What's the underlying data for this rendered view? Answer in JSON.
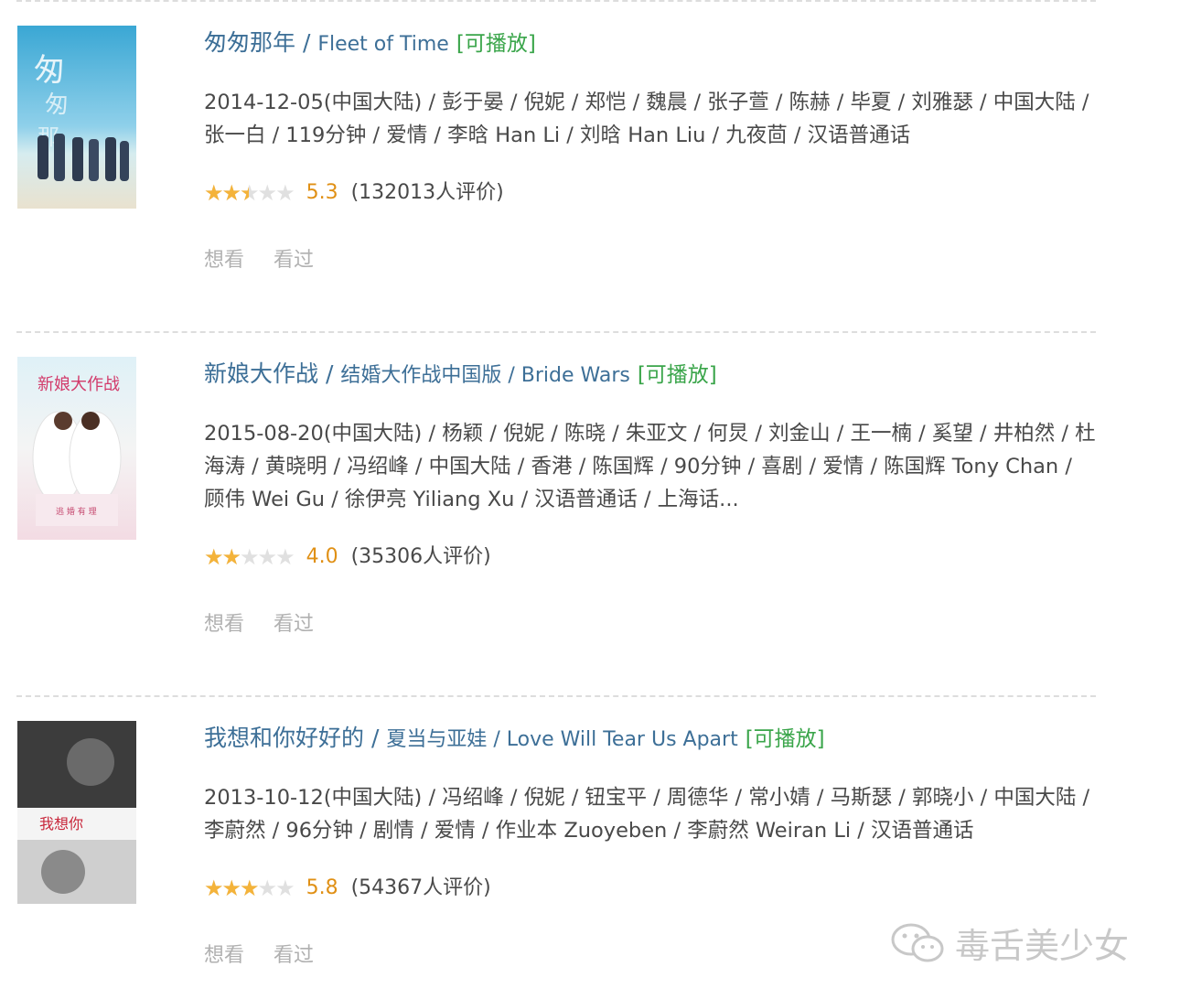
{
  "movies": [
    {
      "title": "匆匆那年",
      "alt_titles": "Fleet of Time",
      "playable": "[可播放]",
      "meta": "2014-12-05(中国大陆) / 彭于晏 / 倪妮 / 郑恺 / 魏晨 / 张子萱 / 陈赫 / 毕夏 / 刘雅瑟 / 中国大陆 / 张一白 / 119分钟 / 爱情 / 李晗 Han Li / 刘晗 Han Liu / 九夜茴 / 汉语普通话",
      "rating": 5.3,
      "score_text": "5.3",
      "votes": "(132013人评价)",
      "want": "想看",
      "seen": "看过",
      "poster_text": "匆匆那年",
      "poster_colors": [
        "#4fb3d6",
        "#bfe6f2"
      ]
    },
    {
      "title": "新娘大作战",
      "alt_titles": "结婚大作战中国版 / Bride Wars",
      "playable": "[可播放]",
      "meta": "2015-08-20(中国大陆) / 杨颖 / 倪妮 / 陈晓 / 朱亚文 / 何炅 / 刘金山 / 王一楠 / 奚望 / 井柏然 / 杜海涛 / 黄晓明 / 冯绍峰 / 中国大陆 / 香港 / 陈国辉 / 90分钟 / 喜剧 / 爱情 / 陈国辉 Tony Chan / 顾伟 Wei Gu / 徐伊亮 Yiliang Xu / 汉语普通话 / 上海话...",
      "rating": 4.0,
      "score_text": "4.0",
      "votes": "(35306人评价)",
      "want": "想看",
      "seen": "看过",
      "poster_text": "新娘大作战",
      "poster_colors": [
        "#d9eef5",
        "#f3d7e2"
      ]
    },
    {
      "title": "我想和你好好的",
      "alt_titles": "夏当与亚娃 / Love Will Tear Us Apart",
      "playable": "[可播放]",
      "meta": "2013-10-12(中国大陆) / 冯绍峰 / 倪妮 / 钮宝平 / 周德华 / 常小婧 / 马斯瑟 / 郭晓小 / 中国大陆 / 李蔚然 / 96分钟 / 剧情 / 爱情 / 作业本 Zuoyeben / 李蔚然 Weiran Li / 汉语普通话",
      "rating": 5.8,
      "score_text": "5.8",
      "votes": "(54367人评价)",
      "want": "想看",
      "seen": "看过",
      "poster_text": "我想你",
      "poster_colors": [
        "#3a3a3a",
        "#e8e8e8"
      ]
    }
  ],
  "watermark": "毒舌美少女"
}
